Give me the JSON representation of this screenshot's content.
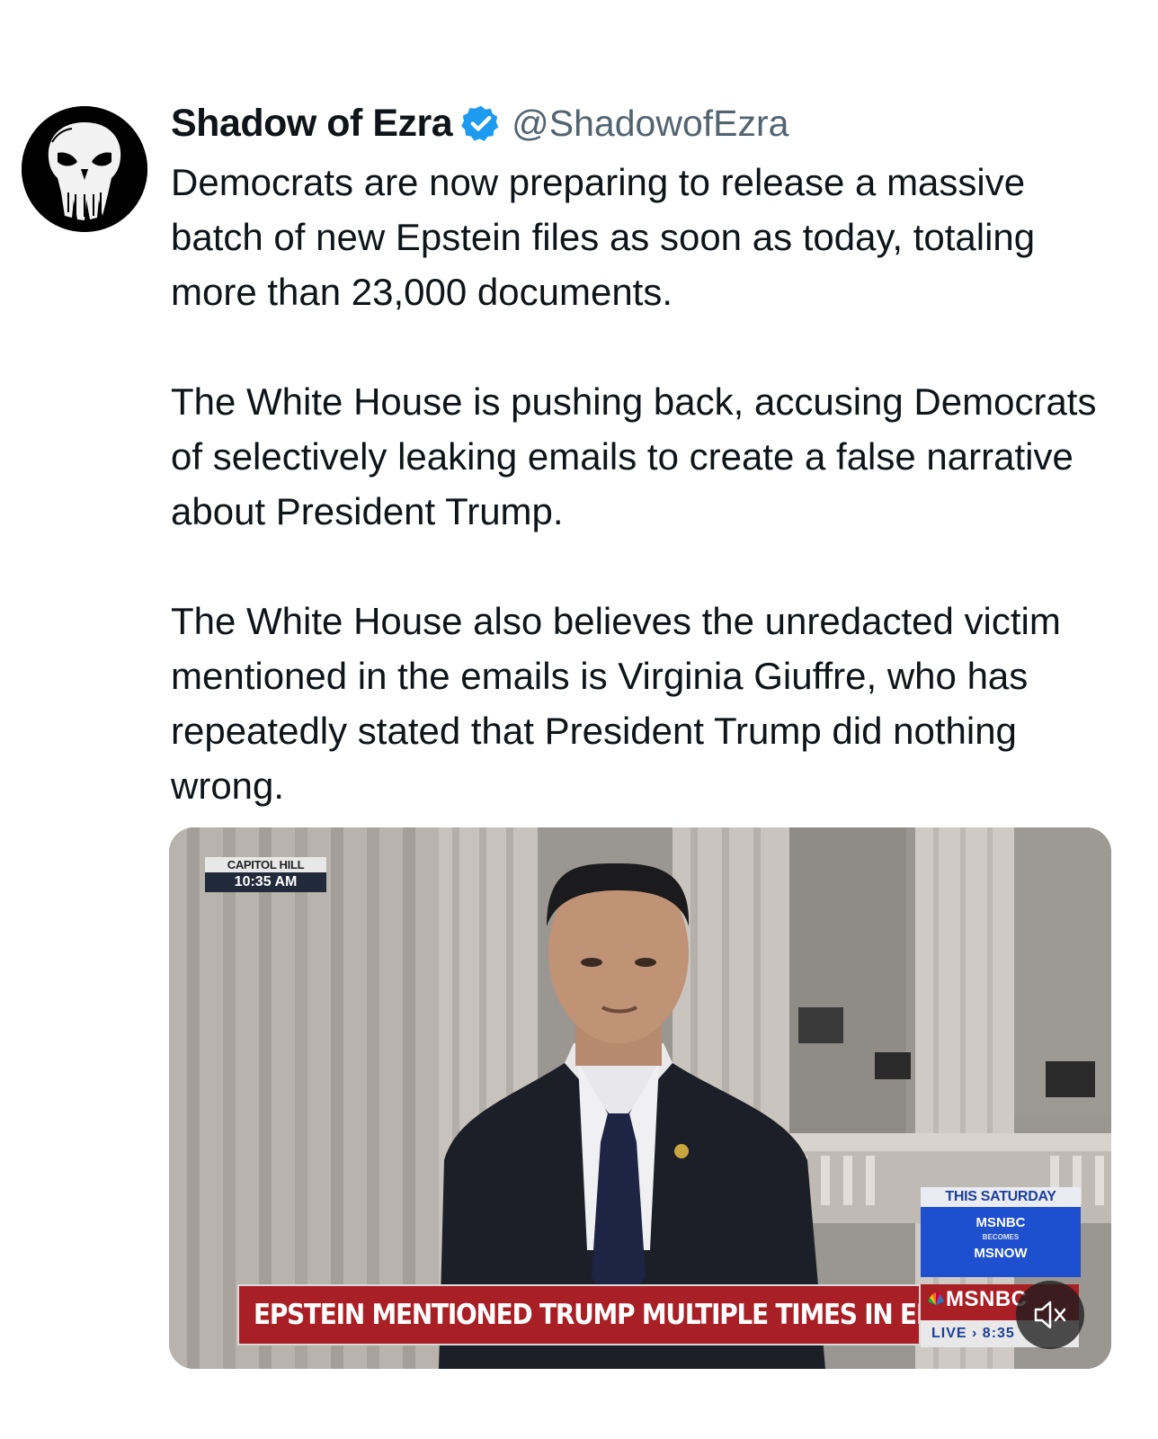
{
  "author": {
    "name": "Shadow of Ezra",
    "handle": "@ShadowofEzra",
    "verified": true,
    "avatar_icon": "punisher-skull-icon"
  },
  "tweet": {
    "paragraphs": [
      "Democrats are now preparing to release a massive batch of new Epstein files as soon as today, totaling more than 23,000 documents.",
      "The White House is pushing back, accusing Democrats of selectively leaking emails to create a false narrative about President Trump.",
      "The White House also believes the unredacted victim mentioned in the emails is Virginia Giuffre, who has repeatedly stated that President Trump did nothing wrong."
    ]
  },
  "video": {
    "location": "CAPITOL HILL",
    "time": "10:35 AM",
    "promo": {
      "top": "THIS SATURDAY",
      "line1": "MSNBC",
      "line2": "BECOMES",
      "line3": "MSNOW"
    },
    "chyron": "EPSTEIN MENTIONED TRUMP MULTIPLE TIMES IN EMAIL",
    "network": "MSNBC",
    "live_label": "LIVE",
    "live_time": "8:35",
    "mute_icon": "speaker-muted-icon"
  },
  "colors": {
    "verified_blue": "#1d9bf0",
    "chyron_red": "#a91f26",
    "promo_blue": "#1e4fcf",
    "handle_gray": "#536471"
  }
}
